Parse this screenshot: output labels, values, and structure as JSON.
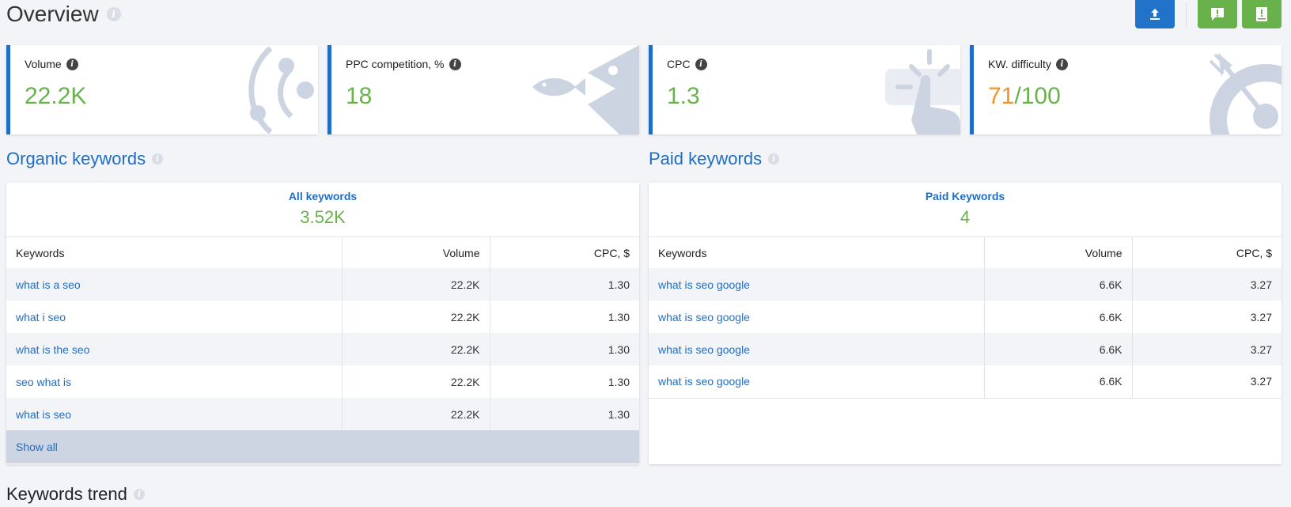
{
  "page": {
    "title": "Overview"
  },
  "actions": {
    "export": "upload-icon",
    "feedback": "alert-icon",
    "help": "help-book-icon"
  },
  "cards": [
    {
      "label": "Volume",
      "value": "22.2K",
      "art": "orbit-illustration"
    },
    {
      "label": "PPC competition, %",
      "value": "18",
      "art": "fish-illustration"
    },
    {
      "label": "CPC",
      "value": "1.3",
      "art": "click-illustration"
    },
    {
      "label": "KW. difficulty",
      "value_main": "71",
      "value_rest": "/100",
      "art": "target-illustration"
    }
  ],
  "organic": {
    "title": "Organic keywords",
    "summary_label": "All keywords",
    "summary_value": "3.52K",
    "columns": [
      "Keywords",
      "Volume",
      "CPC, $"
    ],
    "rows": [
      [
        "what is a seo",
        "22.2K",
        "1.30"
      ],
      [
        "what i seo",
        "22.2K",
        "1.30"
      ],
      [
        "what is the seo",
        "22.2K",
        "1.30"
      ],
      [
        "seo what is",
        "22.2K",
        "1.30"
      ],
      [
        "what is seo",
        "22.2K",
        "1.30"
      ]
    ],
    "show_all": "Show all"
  },
  "paid": {
    "title": "Paid keywords",
    "summary_label": "Paid Keywords",
    "summary_value": "4",
    "columns": [
      "Keywords",
      "Volume",
      "CPC, $"
    ],
    "rows": [
      [
        "what is seo google",
        "6.6K",
        "3.27"
      ],
      [
        "what is seo google",
        "6.6K",
        "3.27"
      ],
      [
        "what is seo google",
        "6.6K",
        "3.27"
      ],
      [
        "what is seo google",
        "6.6K",
        "3.27"
      ]
    ]
  },
  "trend": {
    "title": "Keywords trend"
  },
  "colors": {
    "accent_blue": "#1f6ec5",
    "value_green": "#69b24b",
    "difficulty_orange": "#f29426",
    "button_green": "#69b24b",
    "button_blue": "#2173c9"
  }
}
